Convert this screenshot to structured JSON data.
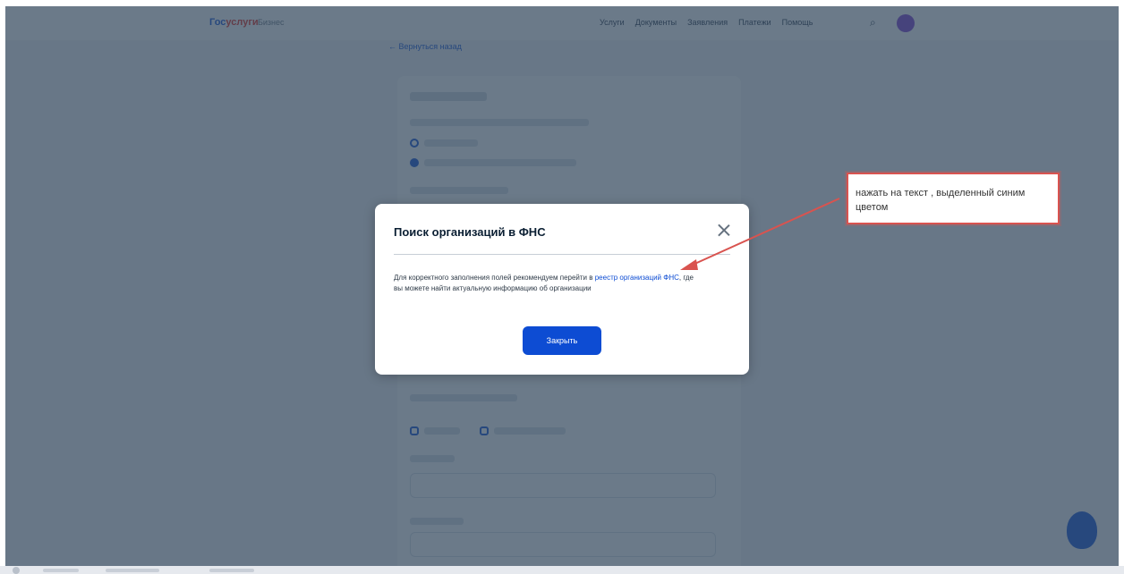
{
  "modal": {
    "title": "Поиск организаций в ФНС",
    "text_before_link": "Для корректного заполнения полей рекомендуем перейти в ",
    "link_text": "реестр организаций ФНС",
    "text_after_link": ", где вы можете найти актуальную информацию об организации",
    "close_button_label": "Закрыть"
  },
  "annotation": {
    "text": "нажать на текст , выделенный синим цветом"
  },
  "colors": {
    "accent": "#0d4cd3",
    "annotation_border": "#d9534f",
    "arrow": "#d9534f",
    "overlay": "#32465c"
  }
}
